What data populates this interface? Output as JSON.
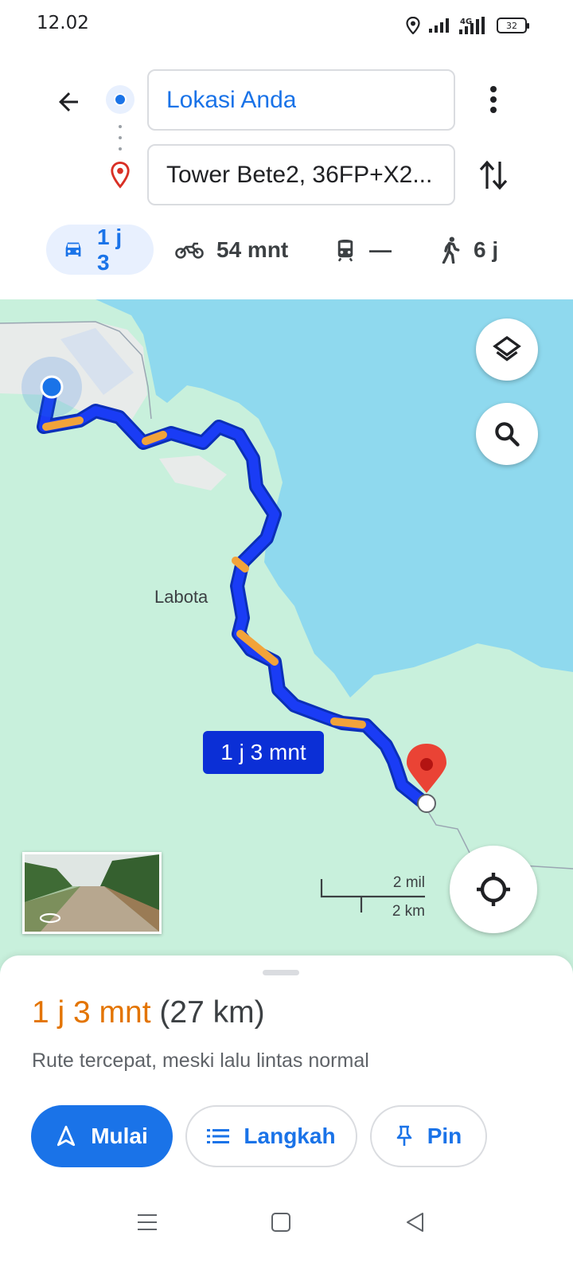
{
  "status_bar": {
    "time": "12.02",
    "battery": "32",
    "network": "4G",
    "icons": [
      "location-icon",
      "signal-icon",
      "signal-4g-icon",
      "battery-icon"
    ]
  },
  "directions": {
    "origin": "Lokasi Anda",
    "destination": "Tower Bete2, 36FP+X2...",
    "icons": {
      "back": "back-arrow-icon",
      "more": "more-vert-icon",
      "swap": "swap-icon",
      "origin": "origin-dot-icon",
      "destination": "destination-pin-icon"
    }
  },
  "modes": [
    {
      "id": "car",
      "label": "1 j 3",
      "icon": "car-icon",
      "active": true
    },
    {
      "id": "motorcycle",
      "label": "54 mnt",
      "icon": "motorcycle-icon",
      "active": false
    },
    {
      "id": "transit",
      "label": "—",
      "icon": "train-icon",
      "active": false
    },
    {
      "id": "walk",
      "label": "6 j",
      "icon": "walk-icon",
      "active": false
    }
  ],
  "map": {
    "place_label": "Labota",
    "route_label": "1 j 3 mnt",
    "scale_mi": "2 mil",
    "scale_km": "2 km",
    "colors": {
      "land": "#c8f0dc",
      "water": "#8fd9ee",
      "route": "#1a3cf5",
      "traffic": "#f2a33a",
      "destination": "#ea4335"
    }
  },
  "sheet": {
    "duration": "1 j 3 mnt",
    "distance": "(27 km)",
    "note": "Rute tercepat, meski lalu lintas normal",
    "buttons": {
      "start": "Mulai",
      "steps": "Langkah",
      "pin": "Pin"
    }
  },
  "colors": {
    "accent": "#1a73e8",
    "duration": "#e37400"
  }
}
